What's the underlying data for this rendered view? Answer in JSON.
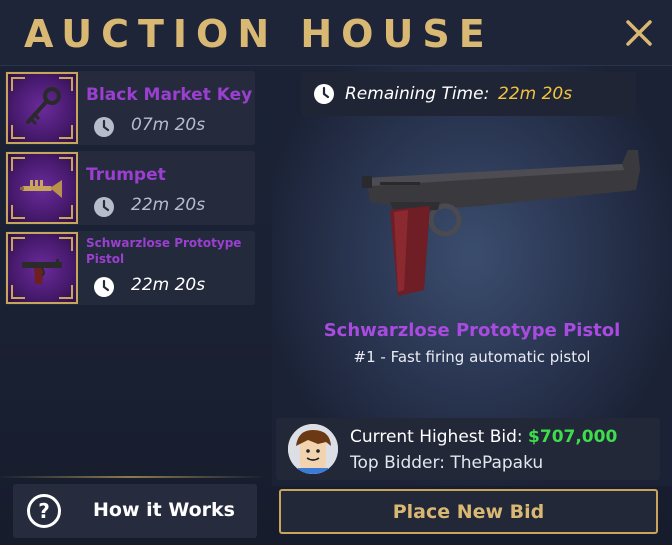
{
  "header": {
    "title": "AUCTION HOUSE"
  },
  "listings": [
    {
      "name": "Black Market Key",
      "time": "07m 20s",
      "icon": "key-icon"
    },
    {
      "name": "Trumpet",
      "time": "22m 20s",
      "icon": "trumpet-icon"
    },
    {
      "name": "Schwarzlose Prototype Pistol",
      "time": "22m 20s",
      "icon": "pistol-icon"
    }
  ],
  "how_it_works": {
    "label": "How it Works",
    "icon": "question-icon"
  },
  "detail": {
    "remaining_label": "Remaining Time:",
    "remaining_value": "22m 20s",
    "item_name": "Schwarzlose Prototype Pistol",
    "item_description": "#1 - Fast firing automatic pistol"
  },
  "bid": {
    "current_label": "Current Highest Bid: ",
    "current_amount": "$707,000",
    "top_bidder_label": "Top Bidder: ",
    "top_bidder_name": "ThePapaku",
    "place_bid_label": "Place New Bid"
  },
  "colors": {
    "gold": "#d9b873",
    "item_purple": "#9a3fd0",
    "bid_green": "#3fdc4c",
    "time_yellow": "#f2c340"
  }
}
